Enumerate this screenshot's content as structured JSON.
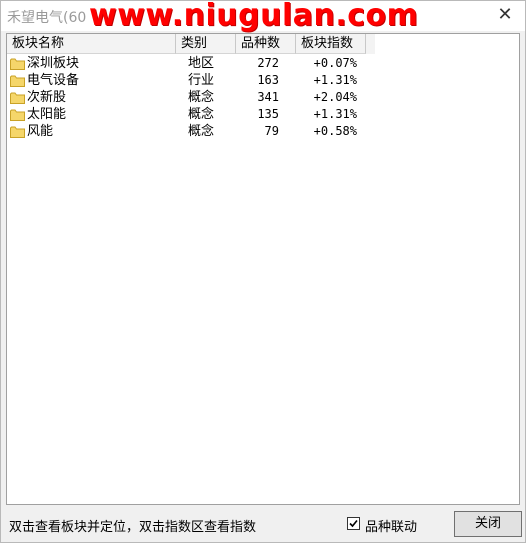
{
  "window": {
    "title": "禾望电气(60",
    "watermark": "www.niugulan.com",
    "close_glyph": "✕"
  },
  "table": {
    "columns": [
      "板块名称",
      "类别",
      "品种数",
      "板块指数"
    ],
    "rows": [
      {
        "name": "深圳板块",
        "category": "地区",
        "count": "272",
        "index": "+0.07%"
      },
      {
        "name": "电气设备",
        "category": "行业",
        "count": "163",
        "index": "+1.31%"
      },
      {
        "name": "次新股",
        "category": "概念",
        "count": "341",
        "index": "+2.04%"
      },
      {
        "name": "太阳能",
        "category": "概念",
        "count": "135",
        "index": "+1.31%"
      },
      {
        "name": "风能",
        "category": "概念",
        "count": "79",
        "index": "+0.58%"
      }
    ],
    "row_icon": "folder-icon"
  },
  "footer": {
    "hint": "双击查看板块并定位，双击指数区查看指数",
    "checkbox_label": "品种联动",
    "checkbox_checked": true,
    "close_label": "关闭"
  },
  "colors": {
    "watermark": "#ff0000",
    "folder_fill": "#f5d66a",
    "folder_edge": "#c9a227"
  }
}
